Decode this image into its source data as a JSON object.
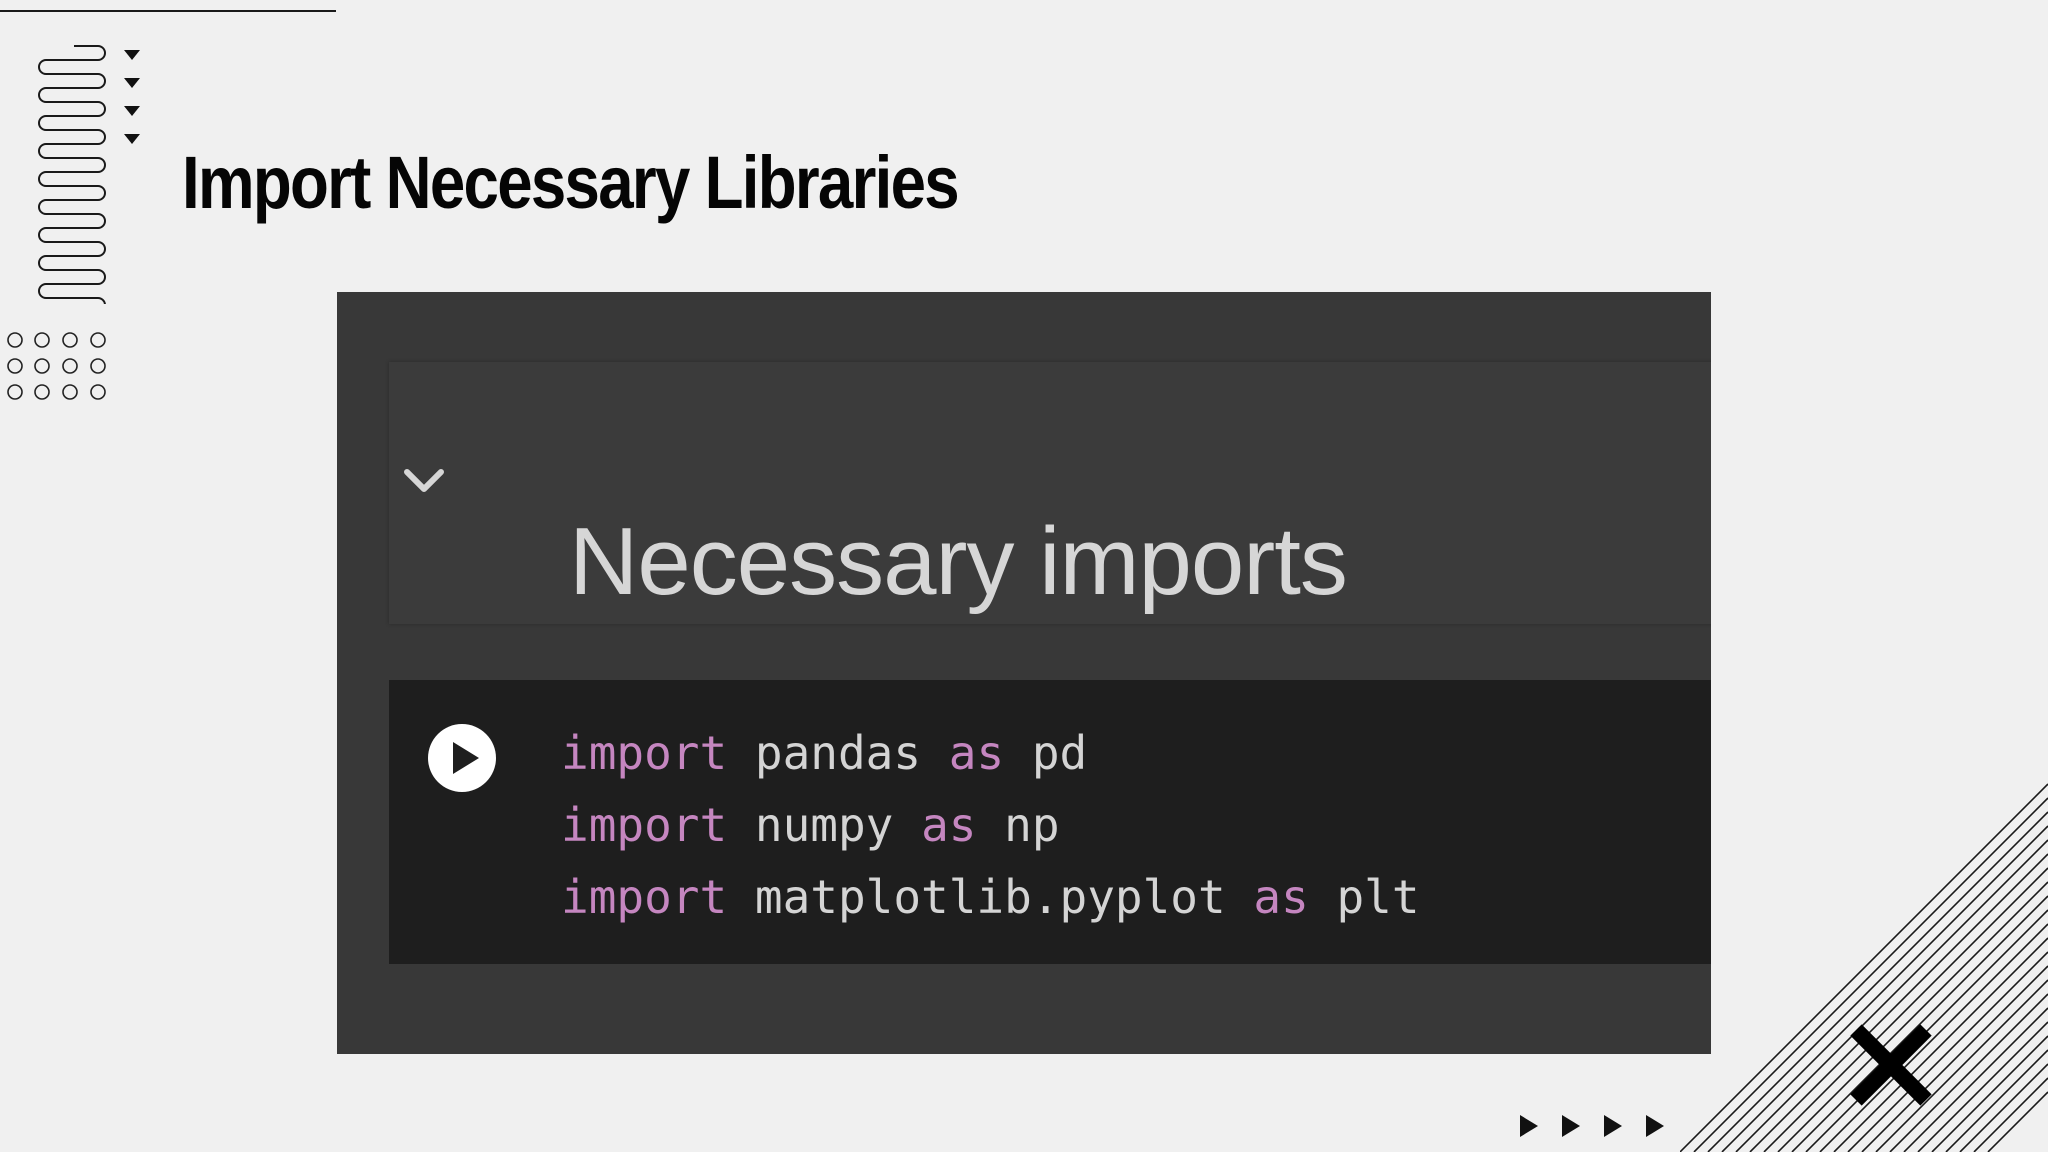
{
  "slide": {
    "title": "Import Necessary Libraries"
  },
  "notebook": {
    "section_heading": "Necessary imports",
    "collapse_icon": "chevron-down-icon",
    "run_icon": "play-circle-icon",
    "code_lines": [
      {
        "keyword": "import",
        "module": "pandas",
        "as_keyword": "as",
        "alias": "pd"
      },
      {
        "keyword": "import",
        "module": "numpy",
        "as_keyword": "as",
        "alias": "np"
      },
      {
        "keyword": "import",
        "module": "matplotlib.pyplot",
        "as_keyword": "as",
        "alias": "plt"
      }
    ]
  },
  "colors": {
    "background": "#f0f0f0",
    "panel": "#383838",
    "code_cell": "#1e1e1e",
    "keyword": "#c586c0",
    "code_text": "#d4d4d4",
    "heading_text": "#d6d6d6"
  }
}
